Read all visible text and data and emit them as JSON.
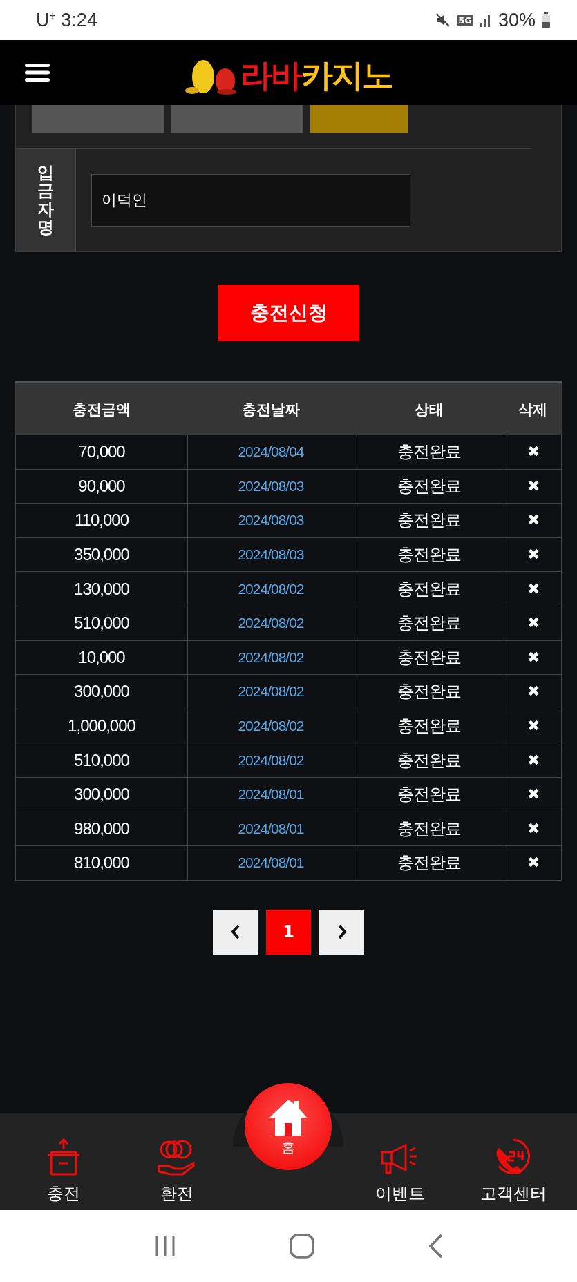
{
  "status_bar": {
    "carrier": "U",
    "carrier_sup": "+",
    "time": "3:24",
    "network": "5G",
    "battery": "30%"
  },
  "header": {
    "logo_parts": [
      {
        "text": "라바",
        "color": "#e8161b"
      },
      {
        "text": "카지노",
        "color": "#ffc21a"
      }
    ]
  },
  "preset_buttons": [
    {
      "selected": false
    },
    {
      "selected": false
    },
    {
      "selected": true
    }
  ],
  "depositor": {
    "label": "입금자명",
    "value": "이덕인"
  },
  "submit_button": "충전신청",
  "table": {
    "columns": [
      "충전금액",
      "충전날짜",
      "상태",
      "삭제"
    ],
    "rows": [
      {
        "amount": "70,000",
        "date": "2024/08/04",
        "status": "충전완료",
        "delete": "✖"
      },
      {
        "amount": "90,000",
        "date": "2024/08/03",
        "status": "충전완료",
        "delete": "✖"
      },
      {
        "amount": "110,000",
        "date": "2024/08/03",
        "status": "충전완료",
        "delete": "✖"
      },
      {
        "amount": "350,000",
        "date": "2024/08/03",
        "status": "충전완료",
        "delete": "✖"
      },
      {
        "amount": "130,000",
        "date": "2024/08/02",
        "status": "충전완료",
        "delete": "✖"
      },
      {
        "amount": "510,000",
        "date": "2024/08/02",
        "status": "충전완료",
        "delete": "✖"
      },
      {
        "amount": "10,000",
        "date": "2024/08/02",
        "status": "충전완료",
        "delete": "✖"
      },
      {
        "amount": "300,000",
        "date": "2024/08/02",
        "status": "충전완료",
        "delete": "✖"
      },
      {
        "amount": "1,000,000",
        "date": "2024/08/02",
        "status": "충전완료",
        "delete": "✖"
      },
      {
        "amount": "510,000",
        "date": "2024/08/02",
        "status": "충전완료",
        "delete": "✖"
      },
      {
        "amount": "300,000",
        "date": "2024/08/01",
        "status": "충전완료",
        "delete": "✖"
      },
      {
        "amount": "980,000",
        "date": "2024/08/01",
        "status": "충전완료",
        "delete": "✖"
      },
      {
        "amount": "810,000",
        "date": "2024/08/01",
        "status": "충전완료",
        "delete": "✖"
      }
    ]
  },
  "pagination": {
    "pages": [
      {
        "label": "1",
        "selected": true
      }
    ]
  },
  "bottom_nav": [
    {
      "kind": "deposit",
      "label": "충전"
    },
    {
      "kind": "exchange",
      "label": "환전"
    },
    {
      "kind": "home",
      "label": "홈"
    },
    {
      "kind": "event",
      "label": "이벤트"
    },
    {
      "kind": "support",
      "label": "고객센터"
    }
  ]
}
